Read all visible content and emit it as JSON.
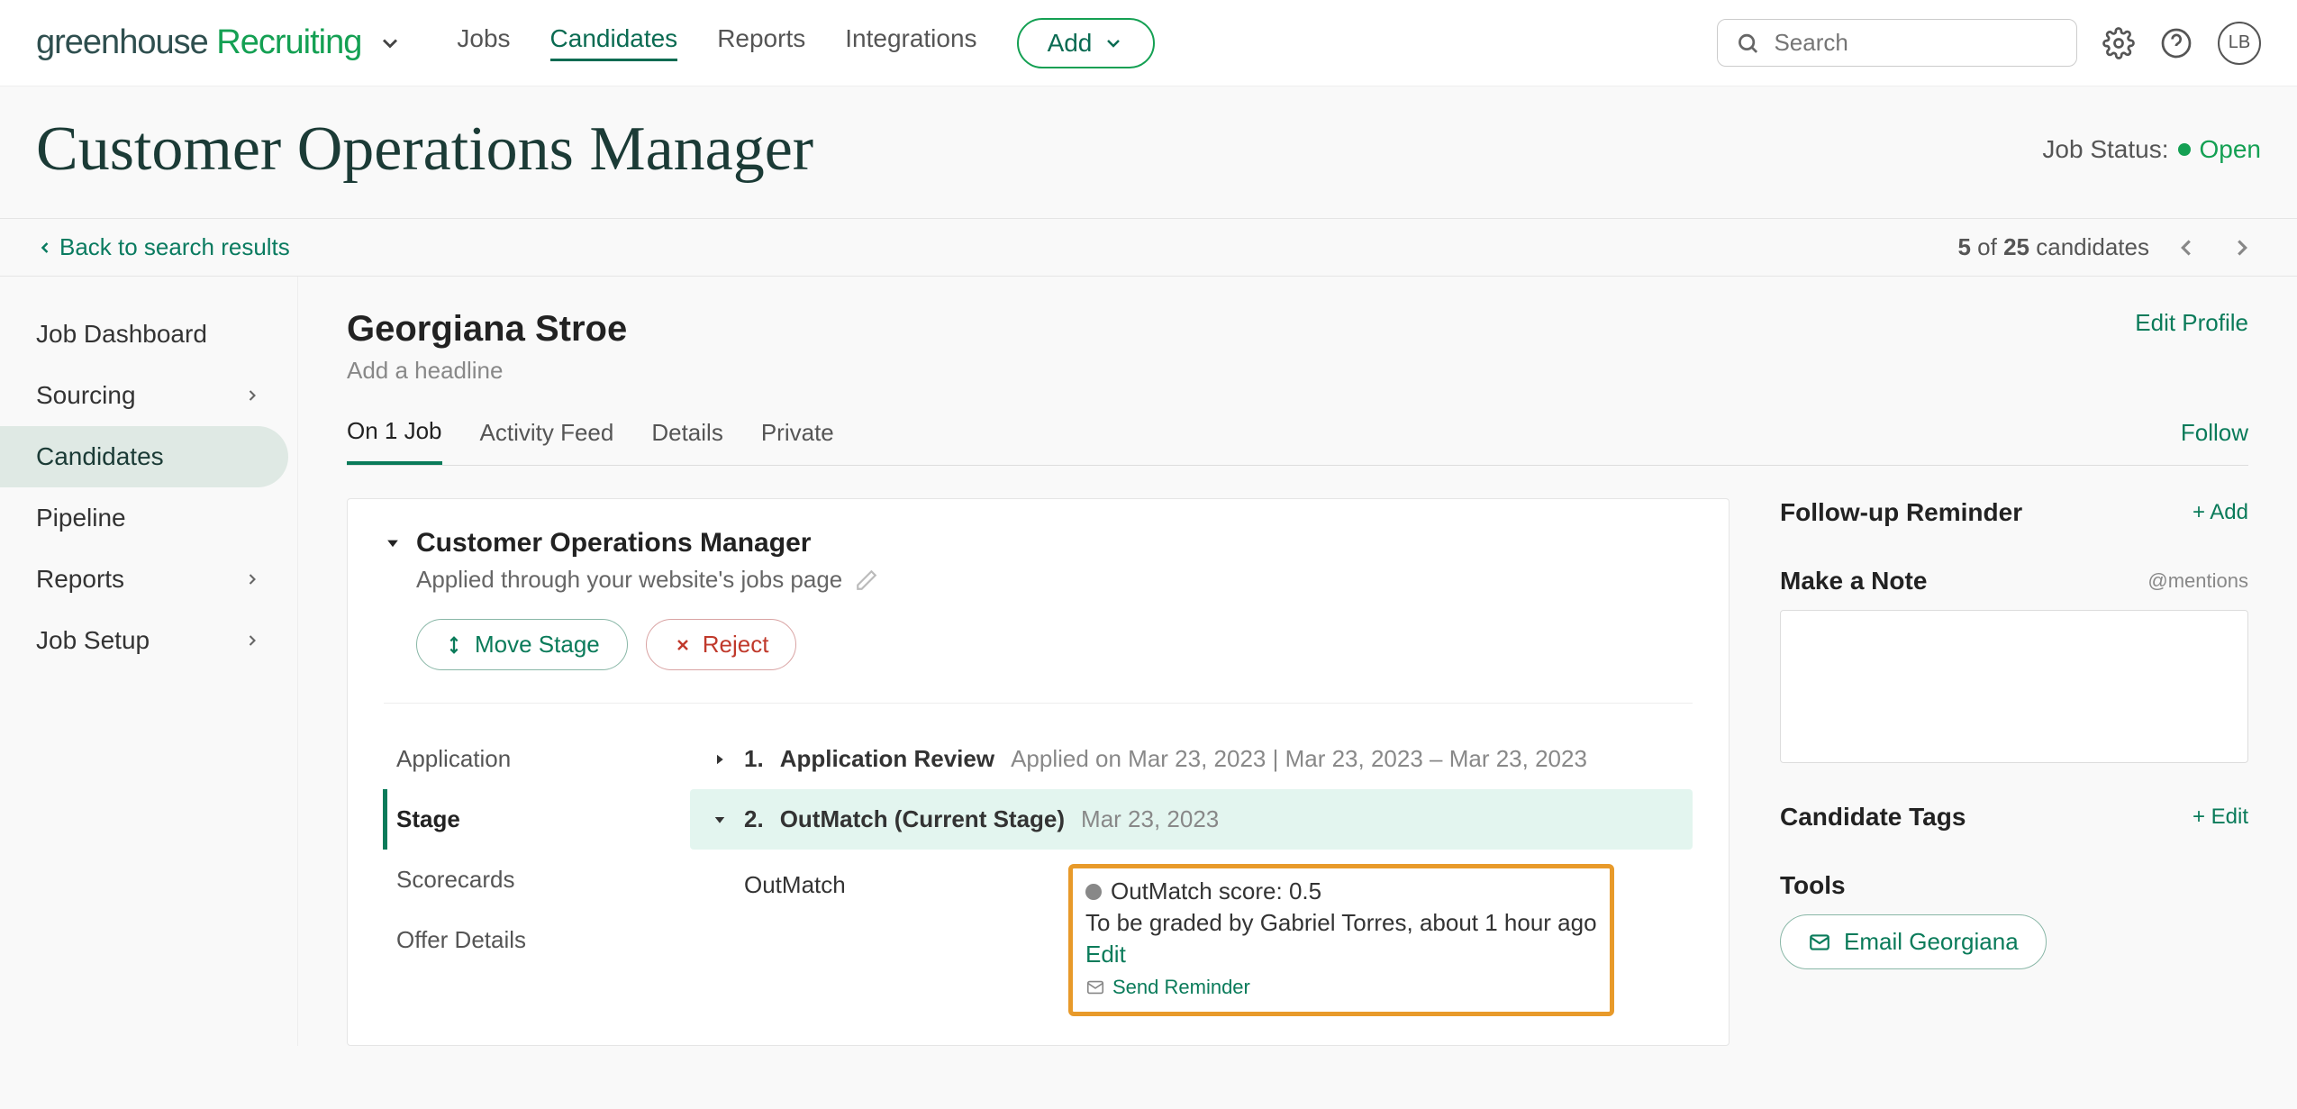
{
  "header": {
    "logo_part1": "greenhouse",
    "logo_part2": "Recruiting",
    "nav": [
      "Jobs",
      "Candidates",
      "Reports",
      "Integrations"
    ],
    "nav_active_index": 1,
    "add_label": "Add",
    "search_placeholder": "Search",
    "avatar_initials": "LB"
  },
  "job": {
    "title": "Customer Operations Manager",
    "status_label": "Job Status:",
    "status_value": "Open"
  },
  "crumbs": {
    "back_label": "Back to search results",
    "position_current": "5",
    "position_of": "of",
    "position_total": "25",
    "position_noun": "candidates"
  },
  "sidebar": {
    "items": [
      {
        "label": "Job Dashboard",
        "has_chevron": false
      },
      {
        "label": "Sourcing",
        "has_chevron": true
      },
      {
        "label": "Candidates",
        "has_chevron": false
      },
      {
        "label": "Pipeline",
        "has_chevron": false
      },
      {
        "label": "Reports",
        "has_chevron": true
      },
      {
        "label": "Job Setup",
        "has_chevron": true
      }
    ],
    "active_index": 2
  },
  "candidate": {
    "name": "Georgiana Stroe",
    "headline_placeholder": "Add a headline",
    "edit_profile_label": "Edit Profile",
    "follow_label": "Follow"
  },
  "tabs": {
    "items": [
      "On 1 Job",
      "Activity Feed",
      "Details",
      "Private"
    ],
    "active_index": 0
  },
  "application": {
    "title": "Customer Operations Manager",
    "via": "Applied through your website's jobs page",
    "move_stage_label": "Move Stage",
    "reject_label": "Reject"
  },
  "stage_tabs": [
    "Application",
    "Stage",
    "Scorecards",
    "Offer Details"
  ],
  "stage_tabs_active_index": 1,
  "stages": {
    "app_review": {
      "num": "1.",
      "name": "Application Review",
      "meta": "Applied on Mar 23, 2023 | Mar 23, 2023 – Mar 23, 2023"
    },
    "outmatch": {
      "num": "2.",
      "name": "OutMatch (Current Stage)",
      "date": "Mar 23, 2023"
    }
  },
  "outmatch_detail": {
    "tool_name": "OutMatch",
    "score_line": "OutMatch score: 0.5",
    "grader_line": "To be graded by Gabriel Torres, about 1 hour ago",
    "edit_label": "Edit",
    "reminder_label": "Send Reminder"
  },
  "rightcol": {
    "followup": {
      "title": "Follow-up Reminder",
      "action": "+ Add"
    },
    "note": {
      "title": "Make a Note",
      "mentions": "@mentions"
    },
    "tags": {
      "title": "Candidate Tags",
      "action": "+ Edit"
    },
    "tools": {
      "title": "Tools",
      "email_label": "Email Georgiana"
    }
  }
}
